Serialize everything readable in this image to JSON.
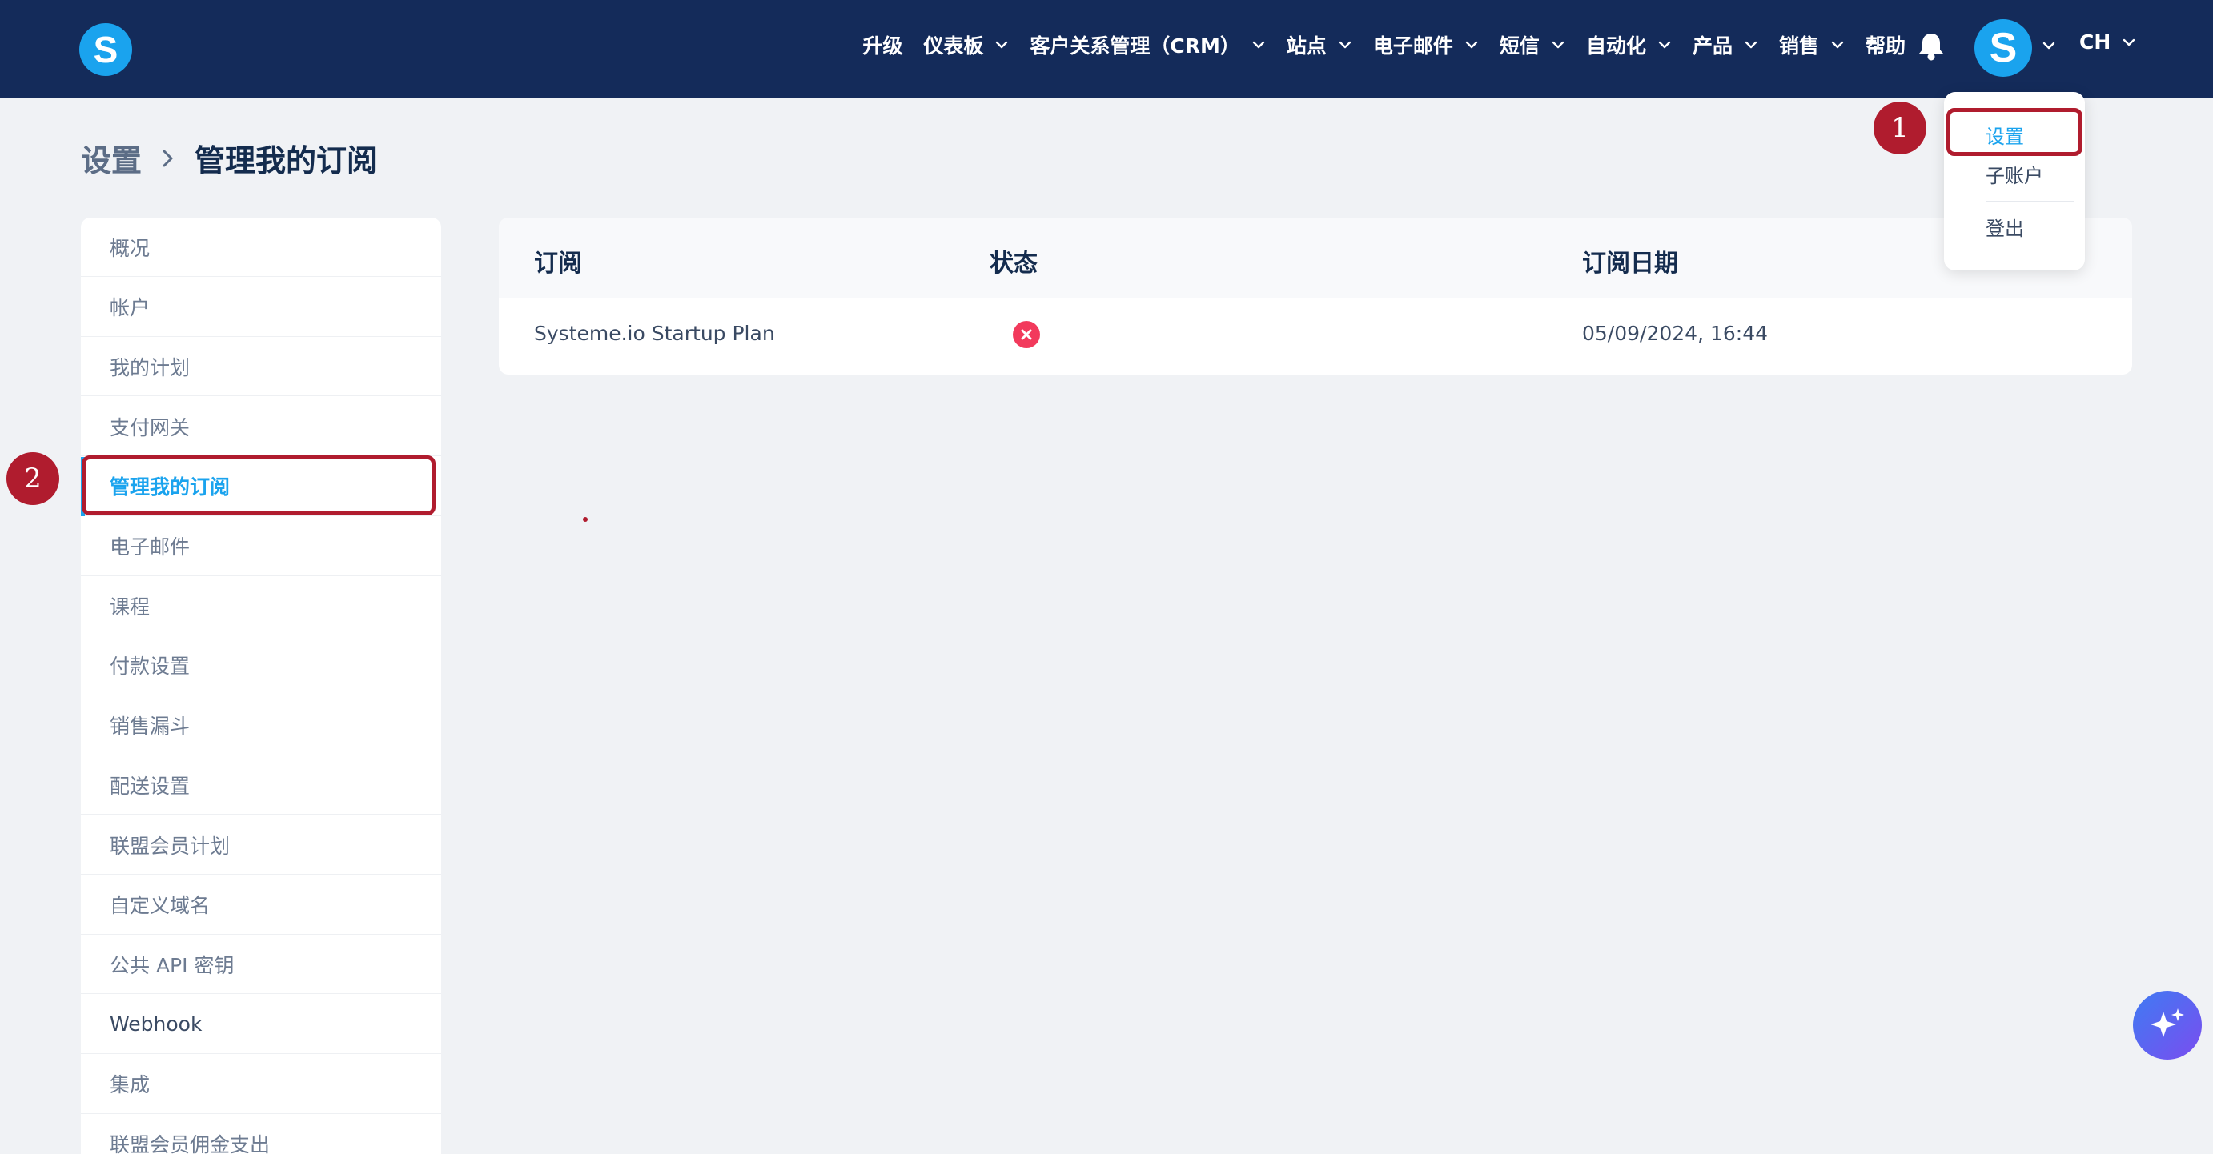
{
  "header": {
    "logo_letter": "S",
    "nav": [
      {
        "label": "升级",
        "has_chevron": false
      },
      {
        "label": "仪表板",
        "has_chevron": true
      },
      {
        "label": "客户关系管理（CRM）",
        "has_chevron": true
      },
      {
        "label": "站点",
        "has_chevron": true
      },
      {
        "label": "电子邮件",
        "has_chevron": true
      },
      {
        "label": "短信",
        "has_chevron": true
      },
      {
        "label": "自动化",
        "has_chevron": true
      },
      {
        "label": "产品",
        "has_chevron": true
      },
      {
        "label": "销售",
        "has_chevron": true
      },
      {
        "label": "帮助",
        "has_chevron": false
      }
    ],
    "avatar_letter": "S",
    "language": "CH"
  },
  "user_menu": {
    "items": [
      "设置",
      "子账户",
      "登出"
    ],
    "active_index": 0
  },
  "annotations": {
    "badge_1": "1",
    "badge_2": "2"
  },
  "breadcrumb": {
    "parent": "设置",
    "current": "管理我的订阅"
  },
  "sidebar": {
    "items": [
      "概况",
      "帐户",
      "我的计划",
      "支付网关",
      "管理我的订阅",
      "电子邮件",
      "课程",
      "付款设置",
      "销售漏斗",
      "配送设置",
      "联盟会员计划",
      "自定义域名",
      "公共 API 密钥",
      "Webhook",
      "集成",
      "联盟会员佣金支出"
    ],
    "active_index": 4
  },
  "subscriptions": {
    "columns": [
      "订阅",
      "状态",
      "订阅日期"
    ],
    "rows": [
      {
        "plan": "Systeme.io Startup Plan",
        "status": "inactive",
        "date": "05/09/2024, 16:44"
      }
    ]
  },
  "colors": {
    "header_bg": "#142b5a",
    "accent": "#1aa3ee",
    "annotation_red": "#b01c2e",
    "status_error": "#f23a5c"
  }
}
